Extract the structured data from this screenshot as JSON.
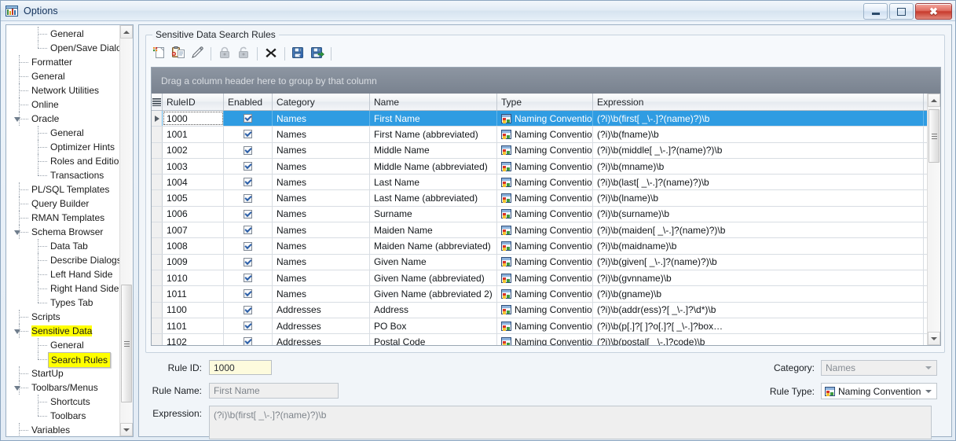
{
  "window": {
    "title": "Options",
    "app_icon": "options-app-icon",
    "buttons": {
      "minimize": "minimize",
      "restore": "restore",
      "close": "close"
    }
  },
  "sidebar": {
    "items": [
      {
        "label": "General",
        "level": 2,
        "state": "leaf",
        "last": false,
        "highlight": "none"
      },
      {
        "label": "Open/Save Dialogs",
        "level": 2,
        "state": "leaf",
        "last": true,
        "highlight": "none"
      },
      {
        "label": "Formatter",
        "level": 1,
        "state": "leaf",
        "last": false,
        "highlight": "none"
      },
      {
        "label": "General",
        "level": 1,
        "state": "leaf",
        "last": false,
        "highlight": "none"
      },
      {
        "label": "Network Utilities",
        "level": 1,
        "state": "leaf",
        "last": false,
        "highlight": "none"
      },
      {
        "label": "Online",
        "level": 1,
        "state": "leaf",
        "last": false,
        "highlight": "none"
      },
      {
        "label": "Oracle",
        "level": 1,
        "state": "open",
        "last": false,
        "highlight": "none"
      },
      {
        "label": "General",
        "level": 2,
        "state": "leaf",
        "last": false,
        "highlight": "none"
      },
      {
        "label": "Optimizer Hints",
        "level": 2,
        "state": "leaf",
        "last": false,
        "highlight": "none"
      },
      {
        "label": "Roles and Editions",
        "level": 2,
        "state": "leaf",
        "last": false,
        "highlight": "none"
      },
      {
        "label": "Transactions",
        "level": 2,
        "state": "leaf",
        "last": true,
        "highlight": "none"
      },
      {
        "label": "PL/SQL Templates",
        "level": 1,
        "state": "leaf",
        "last": false,
        "highlight": "none"
      },
      {
        "label": "Query Builder",
        "level": 1,
        "state": "leaf",
        "last": false,
        "highlight": "none"
      },
      {
        "label": "RMAN Templates",
        "level": 1,
        "state": "leaf",
        "last": false,
        "highlight": "none"
      },
      {
        "label": "Schema Browser",
        "level": 1,
        "state": "open",
        "last": false,
        "highlight": "none"
      },
      {
        "label": "Data Tab",
        "level": 2,
        "state": "leaf",
        "last": false,
        "highlight": "none"
      },
      {
        "label": "Describe Dialogs",
        "level": 2,
        "state": "leaf",
        "last": false,
        "highlight": "none"
      },
      {
        "label": "Left Hand Side",
        "level": 2,
        "state": "leaf",
        "last": false,
        "highlight": "none"
      },
      {
        "label": "Right Hand Side",
        "level": 2,
        "state": "leaf",
        "last": false,
        "highlight": "none"
      },
      {
        "label": "Types Tab",
        "level": 2,
        "state": "leaf",
        "last": true,
        "highlight": "none"
      },
      {
        "label": "Scripts",
        "level": 1,
        "state": "leaf",
        "last": false,
        "highlight": "none"
      },
      {
        "label": "Sensitive Data",
        "level": 1,
        "state": "open",
        "last": false,
        "highlight": "mark"
      },
      {
        "label": "General",
        "level": 2,
        "state": "leaf",
        "last": false,
        "highlight": "none"
      },
      {
        "label": "Search Rules",
        "level": 2,
        "state": "leaf",
        "last": true,
        "highlight": "selected"
      },
      {
        "label": "StartUp",
        "level": 1,
        "state": "leaf",
        "last": false,
        "highlight": "none"
      },
      {
        "label": "Toolbars/Menus",
        "level": 1,
        "state": "open",
        "last": false,
        "highlight": "none"
      },
      {
        "label": "Shortcuts",
        "level": 2,
        "state": "leaf",
        "last": false,
        "highlight": "none"
      },
      {
        "label": "Toolbars",
        "level": 2,
        "state": "leaf",
        "last": true,
        "highlight": "none"
      },
      {
        "label": "Variables",
        "level": 1,
        "state": "leaf",
        "last": false,
        "highlight": "none"
      }
    ]
  },
  "panel": {
    "title": "Sensitive Data Search Rules",
    "toolbar": [
      {
        "name": "new-rule-button",
        "icon": "new-document-icon",
        "enabled": true
      },
      {
        "name": "copy-rule-button",
        "icon": "clipboard-copy-icon",
        "enabled": true
      },
      {
        "name": "edit-rule-button",
        "icon": "pencil-edit-icon",
        "enabled": true
      },
      {
        "name": "sep-1",
        "icon": "separator",
        "enabled": true
      },
      {
        "name": "lock-rule-button",
        "icon": "lock-icon",
        "enabled": false
      },
      {
        "name": "unlock-rule-button",
        "icon": "unlock-icon",
        "enabled": false
      },
      {
        "name": "sep-2",
        "icon": "separator",
        "enabled": true
      },
      {
        "name": "delete-rule-button",
        "icon": "delete-x-icon",
        "enabled": true
      },
      {
        "name": "sep-3",
        "icon": "separator",
        "enabled": true
      },
      {
        "name": "save-rules-button",
        "icon": "save-icon",
        "enabled": true
      },
      {
        "name": "export-rules-button",
        "icon": "save-export-icon",
        "enabled": true
      },
      {
        "name": "sep-4",
        "icon": "separator",
        "enabled": true
      }
    ]
  },
  "grid": {
    "group_hint": "Drag a column header here to group by that column",
    "columns": [
      "RuleID",
      "Enabled",
      "Category",
      "Name",
      "Type",
      "Expression"
    ],
    "selected_row_index": 0,
    "rows": [
      {
        "ruleid": "1000",
        "enabled": true,
        "category": "Names",
        "name": "First Name",
        "type": "Naming Convention",
        "expression": "(?i)\\b(first[ _\\-.]?(name)?)\\b"
      },
      {
        "ruleid": "1001",
        "enabled": true,
        "category": "Names",
        "name": "First Name (abbreviated)",
        "type": "Naming Convention",
        "expression": "(?i)\\b(fname)\\b"
      },
      {
        "ruleid": "1002",
        "enabled": true,
        "category": "Names",
        "name": "Middle Name",
        "type": "Naming Convention",
        "expression": "(?i)\\b(middle[ _\\-.]?(name)?)\\b"
      },
      {
        "ruleid": "1003",
        "enabled": true,
        "category": "Names",
        "name": "Middle Name (abbreviated)",
        "type": "Naming Convention",
        "expression": "(?i)\\b(mname)\\b"
      },
      {
        "ruleid": "1004",
        "enabled": true,
        "category": "Names",
        "name": "Last Name",
        "type": "Naming Convention",
        "expression": "(?i)\\b(last[ _\\-.]?(name)?)\\b"
      },
      {
        "ruleid": "1005",
        "enabled": true,
        "category": "Names",
        "name": "Last Name (abbreviated)",
        "type": "Naming Convention",
        "expression": "(?i)\\b(lname)\\b"
      },
      {
        "ruleid": "1006",
        "enabled": true,
        "category": "Names",
        "name": "Surname",
        "type": "Naming Convention",
        "expression": "(?i)\\b(surname)\\b"
      },
      {
        "ruleid": "1007",
        "enabled": true,
        "category": "Names",
        "name": "Maiden Name",
        "type": "Naming Convention",
        "expression": "(?i)\\b(maiden[ _\\-.]?(name)?)\\b"
      },
      {
        "ruleid": "1008",
        "enabled": true,
        "category": "Names",
        "name": "Maiden Name (abbreviated)",
        "type": "Naming Convention",
        "expression": "(?i)\\b(maidname)\\b"
      },
      {
        "ruleid": "1009",
        "enabled": true,
        "category": "Names",
        "name": "Given Name",
        "type": "Naming Convention",
        "expression": "(?i)\\b(given[ _\\-.]?(name)?)\\b"
      },
      {
        "ruleid": "1010",
        "enabled": true,
        "category": "Names",
        "name": "Given Name (abbreviated)",
        "type": "Naming Convention",
        "expression": "(?i)\\b(gvnname)\\b"
      },
      {
        "ruleid": "1011",
        "enabled": true,
        "category": "Names",
        "name": "Given Name (abbreviated 2)",
        "type": "Naming Convention",
        "expression": "(?i)\\b(gname)\\b"
      },
      {
        "ruleid": "1100",
        "enabled": true,
        "category": "Addresses",
        "name": "Address",
        "type": "Naming Convention",
        "expression": "(?i)\\b(addr(ess)?[ _\\-.]?\\d*)\\b"
      },
      {
        "ruleid": "1101",
        "enabled": true,
        "category": "Addresses",
        "name": "PO Box",
        "type": "Naming Convention",
        "expression": "(?i)\\b(p[.]?[ ]?o[.]?[ _\\-.]?box…"
      },
      {
        "ruleid": "1102",
        "enabled": true,
        "category": "Addresses",
        "name": "Postal Code",
        "type": "Naming Convention",
        "expression": "(?i)\\b(postal[ _\\-.]?code)\\b"
      }
    ]
  },
  "form": {
    "rule_id_label": "Rule ID:",
    "rule_id_value": "1000",
    "rule_name_label": "Rule Name:",
    "rule_name_value": "First Name",
    "expression_label": "Expression:",
    "expression_value": "(?i)\\b(first[ _\\-.]?(name)?)\\b",
    "category_label": "Category:",
    "category_value": "Names",
    "rule_type_label": "Rule Type:",
    "rule_type_value": "Naming Convention"
  }
}
